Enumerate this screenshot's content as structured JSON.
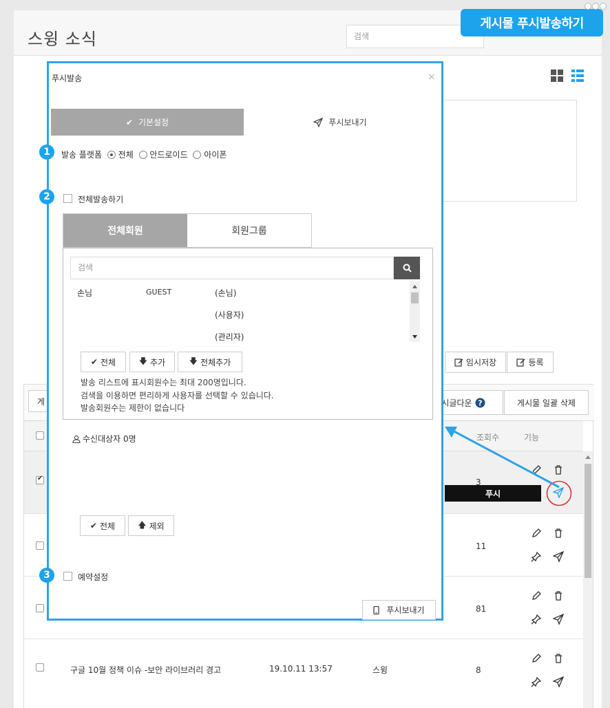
{
  "page": {
    "title": "스윙 소식",
    "search_placeholder": "검색",
    "temp_save": "임시저장",
    "register": "등록",
    "toolbar_left": "게",
    "toolbar_download": "시글다운",
    "bulk_delete": "게시물 일괄 삭제",
    "head_views": "조회수",
    "head_func": "기능",
    "tooltip_push": "푸시",
    "rows": [
      {
        "title": "",
        "date": "",
        "author": "",
        "views": "3",
        "checked": true
      },
      {
        "title": "",
        "date": "",
        "author": "",
        "views": "11",
        "checked": false
      },
      {
        "title": "",
        "date": "",
        "author": "",
        "views": "81",
        "checked": false
      },
      {
        "title": "구글 10월 정책 이슈 -보안 라이브러리 경고",
        "date": "19.10.11 13:57",
        "author": "스윙",
        "views": "8",
        "checked": false
      }
    ]
  },
  "callout": {
    "text": "게시물 푸시발송하기",
    "color": "#1ca3ec"
  },
  "modal": {
    "title": "푸시발송",
    "close": "×",
    "tab_basic": "기본설정",
    "tab_send": "푸시보내기",
    "step1": "1",
    "step2": "2",
    "step3": "3",
    "platform_label": "발송 플랫폼",
    "platform_options": [
      "전체",
      "안드로이드",
      "아이폰"
    ],
    "send_all_label": "전체발송하기",
    "member_tab_all": "전체회원",
    "member_tab_group": "회원그룹",
    "member_search_placeholder": "검색",
    "members": [
      {
        "name": "손님",
        "id": "GUEST",
        "role": "(손님)"
      },
      {
        "name": "",
        "id": "",
        "role": "(사용자)"
      },
      {
        "name": "",
        "id": "",
        "role": "(관리자)"
      }
    ],
    "btn_all": "전체",
    "btn_add": "추가",
    "btn_add_all": "전체추가",
    "info_lines": [
      "발송 리스트에 표시회원수는 최대 200명입니다.",
      "검색을 이용하면 편리하게 사용자를 선택할 수 있습니다.",
      "발송회원수는 제한이 없습니다"
    ],
    "recipients": "수신대상자 0명",
    "btn_all2": "전체",
    "btn_remove": "제외",
    "schedule_label": "예약설정",
    "send_button": "푸시보내기"
  },
  "colors": {
    "accent": "#1ca3ec",
    "modal_border": "#2ea3e6",
    "tab_active": "#a6a6a6",
    "highlight_circle": "#d9363e"
  }
}
